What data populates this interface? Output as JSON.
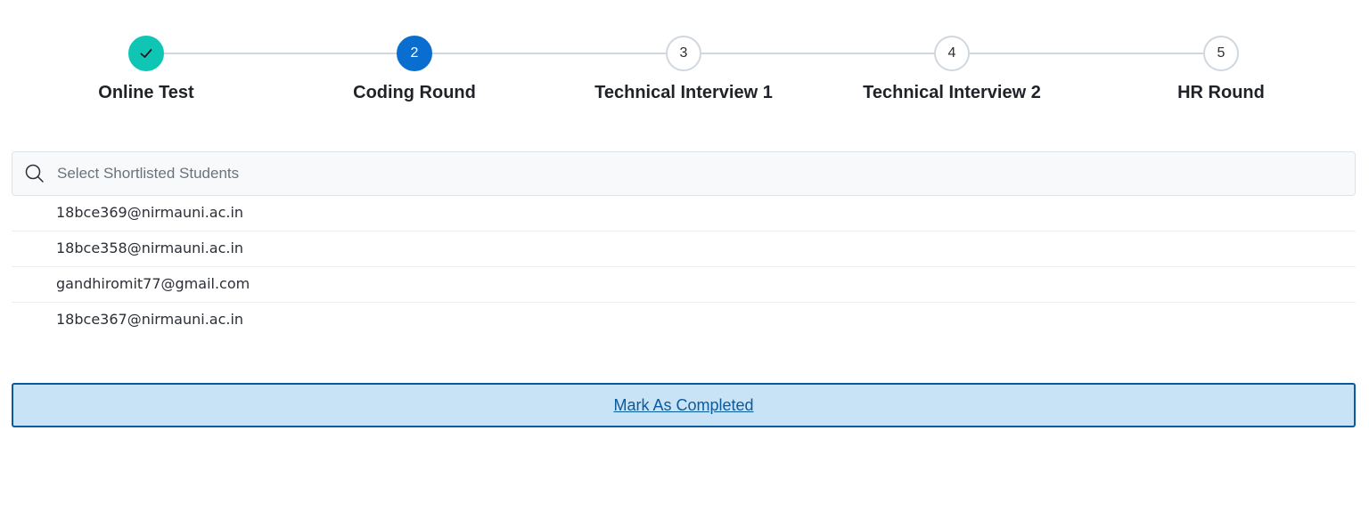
{
  "stepper": {
    "steps": [
      {
        "number": "",
        "label": "Online Test",
        "state": "completed",
        "icon": "check-icon"
      },
      {
        "number": "2",
        "label": "Coding Round",
        "state": "active"
      },
      {
        "number": "3",
        "label": "Technical Interview 1",
        "state": "pending"
      },
      {
        "number": "4",
        "label": "Technical Interview 2",
        "state": "pending"
      },
      {
        "number": "5",
        "label": "HR Round",
        "state": "pending"
      }
    ],
    "colors": {
      "completed": "#0fc6b4",
      "active": "#0a6ed1",
      "pending_border": "#d0d7de"
    }
  },
  "search": {
    "placeholder": "Select Shortlisted Students",
    "value": "",
    "icon": "search-icon"
  },
  "students": [
    "18bce369@nirmauni.ac.in",
    "18bce358@nirmauni.ac.in",
    "gandhiromit77@gmail.com",
    "18bce367@nirmauni.ac.in"
  ],
  "actions": {
    "mark_completed_label": "Mark As Completed",
    "button_color": "#c8e3f6",
    "button_border": "#0a5a9c"
  }
}
